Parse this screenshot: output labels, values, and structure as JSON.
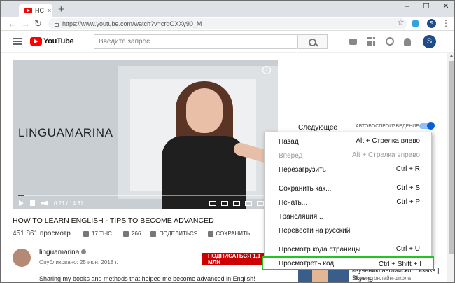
{
  "browser": {
    "tab_title": "НС",
    "tab_close": "×",
    "new_tab": "+",
    "window_controls": [
      "–",
      "☐",
      "✕"
    ],
    "url": "https://www.youtube.com/watch?v=crqOXXy90_M",
    "profile_letter": "S",
    "icons": [
      "back-icon",
      "forward-icon",
      "reload-icon",
      "lock-icon",
      "star-icon",
      "telegram-icon",
      "menu-dots-icon"
    ]
  },
  "youtube": {
    "logo": "YouTube",
    "search_placeholder": "Введите запрос",
    "avatar_letter": "S",
    "icons": [
      "hamburger-icon",
      "search-icon",
      "camera-icon",
      "apps-icon",
      "chat-icon",
      "bell-icon"
    ]
  },
  "player": {
    "overlay_text": "LINGUAMARINA",
    "time": "0:21 / 14:31",
    "progress_fraction": 0.024,
    "info_icon": "i"
  },
  "video": {
    "title": "HOW TO LEARN ENGLISH - TIPS TO BECOME ADVANCED",
    "views": "451 861 просмотр",
    "likes": "17 ТЫС.",
    "dislikes": "266",
    "share": "ПОДЕЛИТЬСЯ",
    "save": "СОХРАНИТЬ",
    "channel": "linguamarina",
    "published": "Опубликовано: 25 июн. 2018 г.",
    "subscribe": "ПОДПИСАТЬСЯ  1,1 МЛН",
    "description": "Sharing my books and methods that helped me become advanced in English!"
  },
  "sidebar": {
    "up_next": "Следующее",
    "autoplay": "АВТОВОСПРОИЗВЕДЕНИЕ",
    "rec_title": "Как отличные советы по изучению английского языка | Skyeng",
    "rec_channel": "Skyeng: онлайн-школа"
  },
  "context_menu": {
    "items": [
      {
        "label": "Назад",
        "shortcut": "Alt + Стрелка влево",
        "disabled": false
      },
      {
        "label": "Вперед",
        "shortcut": "Alt + Стрелка вправо",
        "disabled": true
      },
      {
        "label": "Перезагрузить",
        "shortcut": "Ctrl + R",
        "disabled": false
      },
      {
        "label": "Сохранить как...",
        "shortcut": "Ctrl + S",
        "disabled": false
      },
      {
        "label": "Печать...",
        "shortcut": "Ctrl + P",
        "disabled": false
      },
      {
        "label": "Трансляция...",
        "shortcut": "",
        "disabled": false
      },
      {
        "label": "Перевести на русский",
        "shortcut": "",
        "disabled": false
      },
      {
        "label": "Просмотр кода страницы",
        "shortcut": "Ctrl + U",
        "disabled": false
      },
      {
        "label": "Просмотреть код",
        "shortcut": "Ctrl + Shift + I",
        "disabled": false
      }
    ],
    "highlight_color": "#22c322"
  },
  "colors": {
    "youtube_red": "#ff0000",
    "subscribe_red": "#cc0000",
    "toggle_blue": "#065fd4"
  }
}
